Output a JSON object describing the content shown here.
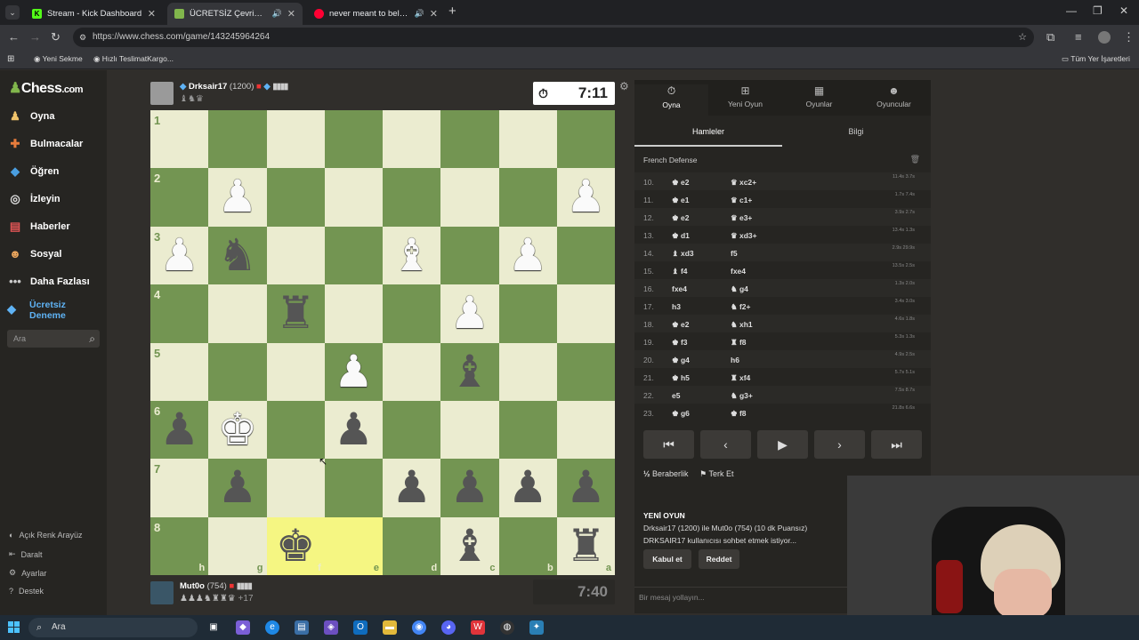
{
  "browser": {
    "tabs": [
      {
        "title": "Stream - Kick Dashboard",
        "favicon_color": "#53fc18",
        "favicon_letter": "K"
      },
      {
        "title": "ÜCRETSİZ Çevrimiçi Satranç",
        "favicon_color": "#81b64c",
        "favicon_letter": "♟"
      },
      {
        "title": "never meant to belong - Yo",
        "favicon_color": "#ff0033",
        "favicon_letter": "▶"
      }
    ],
    "url": "https://www.chess.com/game/143245964264",
    "bookmarks": {
      "new_tab": "Yeni Sekme",
      "cargo": "Hızlı TeslimatKargo...",
      "all": "Tüm Yer İşaretleri"
    }
  },
  "sidebar": {
    "logo_text": "Chess",
    "logo_suffix": ".com",
    "items": [
      {
        "label": "Oyna",
        "icon": "play-icon"
      },
      {
        "label": "Bulmacalar",
        "icon": "puzzle-icon"
      },
      {
        "label": "Öğren",
        "icon": "learn-icon"
      },
      {
        "label": "İzleyin",
        "icon": "watch-icon"
      },
      {
        "label": "Haberler",
        "icon": "news-icon"
      },
      {
        "label": "Sosyal",
        "icon": "social-icon"
      },
      {
        "label": "Daha Fazlası",
        "icon": "more-icon"
      }
    ],
    "trial_line1": "Ücretsiz",
    "trial_line2": "Deneme",
    "search_placeholder": "Ara",
    "footer": [
      {
        "label": "Açık Renk Arayüz"
      },
      {
        "label": "Daralt"
      },
      {
        "label": "Ayarlar"
      },
      {
        "label": "Destek"
      }
    ]
  },
  "top_player": {
    "name": "Drksair17",
    "rating": "(1200)",
    "clock": "7:11",
    "captured": "♝♞♛"
  },
  "bottom_player": {
    "name": "Mut0o",
    "rating": "(754)",
    "clock": "7:40",
    "captured": "♟♟♟♞♜♜♛",
    "advantage": "+17"
  },
  "board": {
    "ranks": [
      "1",
      "2",
      "3",
      "4",
      "5",
      "6",
      "7",
      "8"
    ],
    "files": [
      "h",
      "g",
      "f",
      "e",
      "d",
      "c",
      "b",
      "a"
    ],
    "highlight": [
      [
        7,
        2
      ],
      [
        7,
        3
      ]
    ],
    "pieces": [
      {
        "r": 1,
        "c": 1,
        "p": "♟",
        "w": true
      },
      {
        "r": 1,
        "c": 7,
        "p": "♟",
        "w": true
      },
      {
        "r": 2,
        "c": 0,
        "p": "♟",
        "w": true
      },
      {
        "r": 2,
        "c": 1,
        "p": "♞",
        "w": false
      },
      {
        "r": 2,
        "c": 4,
        "p": "♝",
        "w": true
      },
      {
        "r": 2,
        "c": 6,
        "p": "♟",
        "w": true
      },
      {
        "r": 3,
        "c": 2,
        "p": "♜",
        "w": false
      },
      {
        "r": 3,
        "c": 5,
        "p": "♟",
        "w": true
      },
      {
        "r": 4,
        "c": 3,
        "p": "♟",
        "w": true
      },
      {
        "r": 4,
        "c": 5,
        "p": "♝",
        "w": false
      },
      {
        "r": 5,
        "c": 0,
        "p": "♟",
        "w": false
      },
      {
        "r": 5,
        "c": 1,
        "p": "♚",
        "w": true
      },
      {
        "r": 5,
        "c": 3,
        "p": "♟",
        "w": false
      },
      {
        "r": 6,
        "c": 1,
        "p": "♟",
        "w": false
      },
      {
        "r": 6,
        "c": 4,
        "p": "♟",
        "w": false
      },
      {
        "r": 6,
        "c": 5,
        "p": "♟",
        "w": false
      },
      {
        "r": 6,
        "c": 6,
        "p": "♟",
        "w": false
      },
      {
        "r": 6,
        "c": 7,
        "p": "♟",
        "w": false
      },
      {
        "r": 7,
        "c": 2,
        "p": "♚",
        "w": false
      },
      {
        "r": 7,
        "c": 5,
        "p": "♝",
        "w": false
      },
      {
        "r": 7,
        "c": 7,
        "p": "♜",
        "w": false
      }
    ]
  },
  "panel": {
    "tabs": [
      {
        "label": "Oyna",
        "icon": "clock-icon"
      },
      {
        "label": "Yeni Oyun",
        "icon": "plus-icon"
      },
      {
        "label": "Oyunlar",
        "icon": "board-icon"
      },
      {
        "label": "Oyuncular",
        "icon": "players-icon"
      }
    ],
    "subtabs": [
      "Hamleler",
      "Bilgi"
    ],
    "opening": "French Defense",
    "moves": [
      {
        "n": "10.",
        "w": "♚ e2",
        "b": "♛ xc2+",
        "t": "11.4s 3.7s"
      },
      {
        "n": "11.",
        "w": "♚ e1",
        "b": "♛ c1+",
        "t": "1.7s 7.4s"
      },
      {
        "n": "12.",
        "w": "♚ e2",
        "b": "♛ e3+",
        "t": "3.9s 2.7s"
      },
      {
        "n": "13.",
        "w": "♚ d1",
        "b": "♛ xd3+",
        "t": "13.4s 1.3s"
      },
      {
        "n": "14.",
        "w": "♝ xd3",
        "b": "f5",
        "t": "2.9s 29.9s"
      },
      {
        "n": "15.",
        "w": "♝ f4",
        "b": "fxe4",
        "t": "13.5s 2.5s"
      },
      {
        "n": "16.",
        "w": "fxe4",
        "b": "♞ g4",
        "t": "1.3s 2.0s"
      },
      {
        "n": "17.",
        "w": "h3",
        "b": "♞ f2+",
        "t": "3.4s 3.0s"
      },
      {
        "n": "18.",
        "w": "♚ e2",
        "b": "♞ xh1",
        "t": "4.6s 1.8s"
      },
      {
        "n": "19.",
        "w": "♚ f3",
        "b": "♜ f8",
        "t": "5.3s 1.3s"
      },
      {
        "n": "20.",
        "w": "♚ g4",
        "b": "h6",
        "t": "4.9s 2.5s"
      },
      {
        "n": "21.",
        "w": "♚ h5",
        "b": "♜ xf4",
        "t": "5.7s 5.1s"
      },
      {
        "n": "22.",
        "w": "e5",
        "b": "♞ g3+",
        "t": "7.5s 8.7s"
      },
      {
        "n": "23.",
        "w": "♚ g6",
        "b": "♚ f8",
        "t": "21.8s 6.6s"
      }
    ],
    "controls": [
      "⏮",
      "◀",
      "▶",
      "▶",
      "⏭"
    ],
    "draw_label": "Beraberlik",
    "resign_label": "Terk Et",
    "new_game_title": "YENİ OYUN",
    "new_game_players": "Drksair17 (1200) ile Mut0o (754) (10 dk Puansız)",
    "new_game_chat": "DRKSAIR17 kullanıcısı sohbet etmek istiyor...",
    "accept_label": "Kabul et",
    "decline_label": "Reddet",
    "chat_placeholder": "Bir mesaj yollayın..."
  },
  "taskbar": {
    "search": "Ara"
  }
}
